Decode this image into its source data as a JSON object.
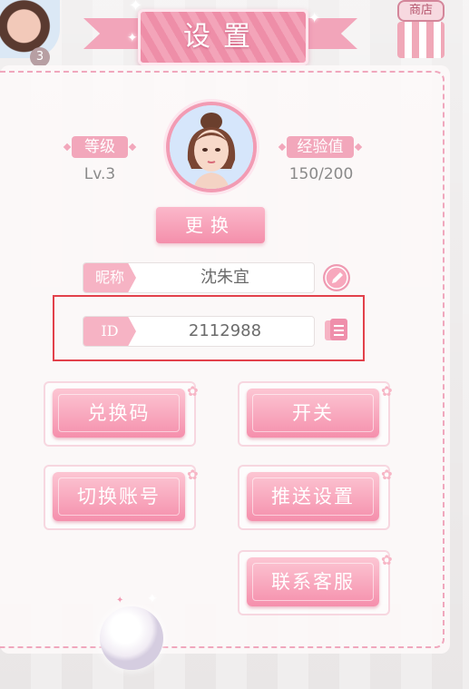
{
  "header": {
    "title": "设置",
    "shop_label": "商店",
    "player_level_badge": "3"
  },
  "profile": {
    "level_label": "等级",
    "level_value": "Lv.3",
    "exp_label": "经验值",
    "exp_value": "150/200",
    "change_button": "更换"
  },
  "fields": {
    "nickname_tag": "昵称",
    "nickname_value": "沈朱宜",
    "id_tag": "ID",
    "id_value": "2112988"
  },
  "menu": {
    "redeem_code": "兑换码",
    "toggle": "开关",
    "switch_account": "切换账号",
    "push_settings": "推送设置",
    "contact_support": "联系客服"
  },
  "icons": {
    "edit": "pencil-icon",
    "copy": "copy-icon",
    "decoration": "flower-icon"
  },
  "colors": {
    "accent_pink": "#f48fab",
    "highlight_red": "#e2414b",
    "text_gray": "#8a8a8a"
  }
}
